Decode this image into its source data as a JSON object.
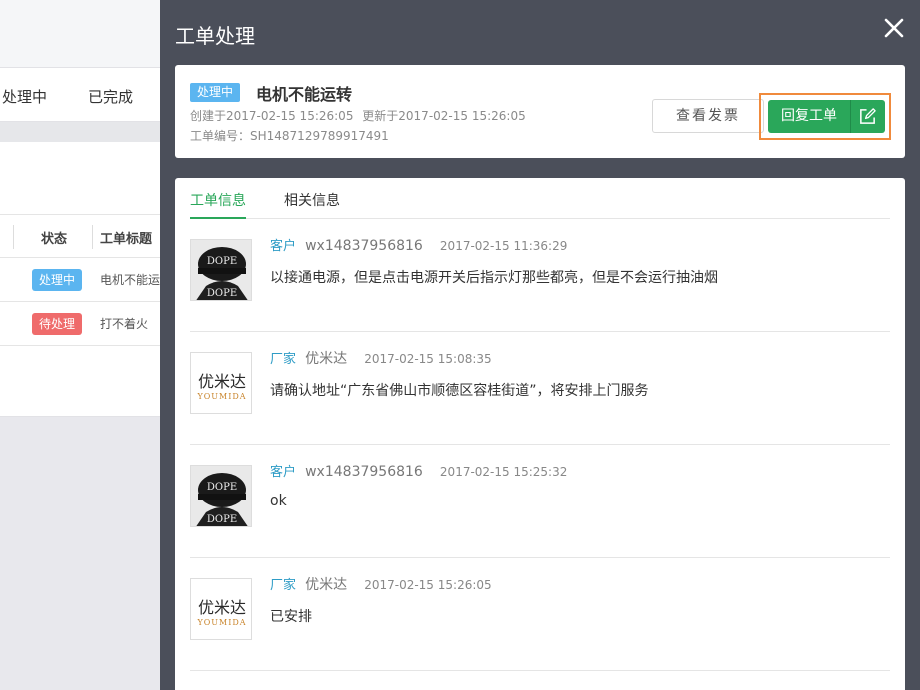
{
  "background": {
    "tabs": [
      "处理中",
      "已完成"
    ],
    "table_headers": [
      "状态",
      "工单标题"
    ],
    "rows": [
      {
        "status": "处理中",
        "status_color": "#5bb5f0",
        "title": "电机不能运转"
      },
      {
        "status": "待处理",
        "status_color": "#ef6b6b",
        "title": "打不着火"
      }
    ]
  },
  "drawer": {
    "title": "工单处理",
    "close_icon": "close-icon",
    "summary": {
      "status_tag": "处理中",
      "title": "电机不能运转",
      "created": "创建于2017-02-15 15:26:05",
      "updated": "更新于2017-02-15 15:26:05",
      "number": "工单编号：SH1487129789917491",
      "invoice_button": "查看发票",
      "reply_button": "回复工单",
      "reply_icon": "edit-icon"
    },
    "tabs": [
      "工单信息",
      "相关信息"
    ],
    "active_tab": "工单信息",
    "messages": [
      {
        "avatar": "dope-avatar",
        "role": "客户",
        "user": "wx14837956816",
        "time": "2017-02-15 11:36:29",
        "text": "以接通电源，但是点击电源开关后指示灯那些都亮，但是不会运行抽油烟"
      },
      {
        "avatar": "youmida-logo",
        "role": "厂家",
        "user": "优米达",
        "time": "2017-02-15 15:08:35",
        "text": "请确认地址“广东省佛山市顺德区容桂街道”，将安排上门服务"
      },
      {
        "avatar": "dope-avatar",
        "role": "客户",
        "user": "wx14837956816",
        "time": "2017-02-15 15:25:32",
        "text": "ok"
      },
      {
        "avatar": "youmida-logo",
        "role": "厂家",
        "user": "优米达",
        "time": "2017-02-15 15:26:05",
        "text": "已安排"
      }
    ],
    "logo_text": {
      "cn": "优米达",
      "en": "YOUMIDA"
    },
    "avatar_text": {
      "top": "DOPE",
      "bottom": "DOPE"
    }
  },
  "colors": {
    "accent_green": "#2aa75a",
    "accent_blue": "#5bb5f0",
    "highlight_orange": "#f08a3c",
    "overlay": "#4b4f5a"
  }
}
